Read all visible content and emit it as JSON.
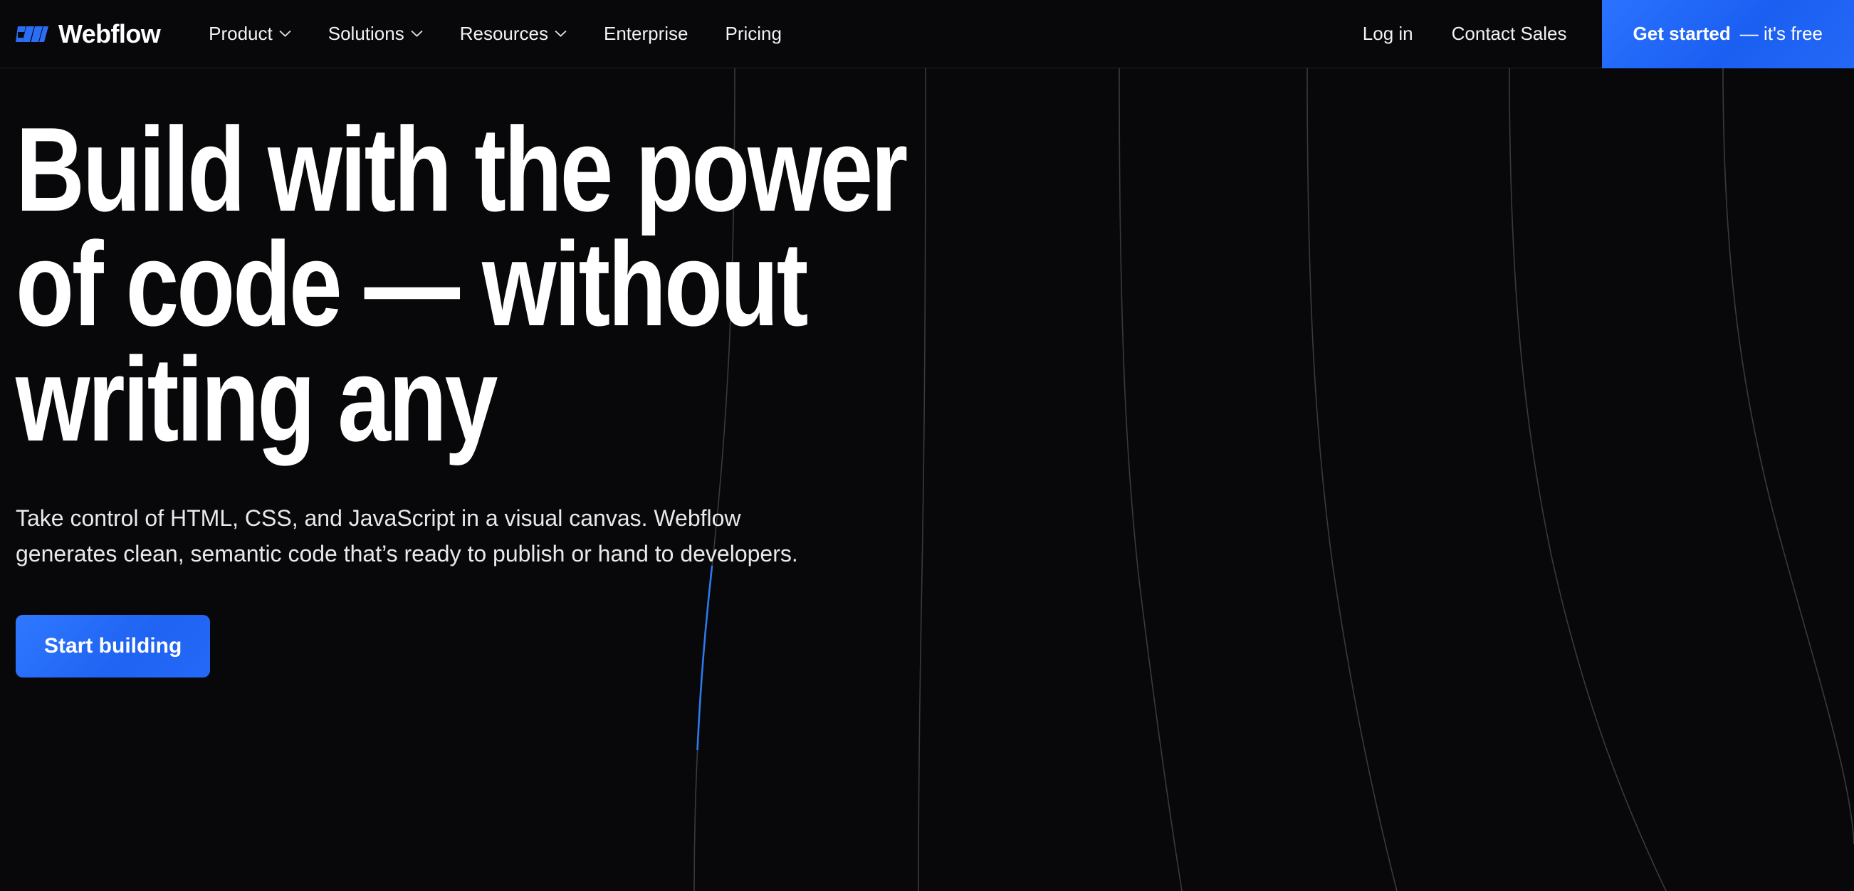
{
  "brand": {
    "name": "Webflow",
    "logo_icon": "webflow-w-logo",
    "logo_color": "#2b6ef5"
  },
  "header": {
    "nav_items": [
      {
        "label": "Product",
        "has_dropdown": true,
        "icon": "chevron-down-icon"
      },
      {
        "label": "Solutions",
        "has_dropdown": true,
        "icon": "chevron-down-icon"
      },
      {
        "label": "Resources",
        "has_dropdown": true,
        "icon": "chevron-down-icon"
      },
      {
        "label": "Enterprise",
        "has_dropdown": false,
        "icon": ""
      },
      {
        "label": "Pricing",
        "has_dropdown": false,
        "icon": ""
      }
    ],
    "login_label": "Log in",
    "contact_label": "Contact Sales",
    "cta_strong": "Get started",
    "cta_sub": "— it's free",
    "cta_color": "#2165f5"
  },
  "hero": {
    "headline_lines": [
      "Build with the power",
      "of code — without",
      "writing any"
    ],
    "subhead_lines": [
      "Take control of HTML, CSS, and JavaScript in a visual canvas. Webflow",
      "generates clean, semantic code that’s ready to publish or hand to developers."
    ],
    "cta_label": "Start building",
    "cta_color": "#2569f8",
    "background": {
      "color": "#08080a",
      "line_color": "#3a3a3e",
      "accent_line_color": "#2b7df5"
    }
  }
}
